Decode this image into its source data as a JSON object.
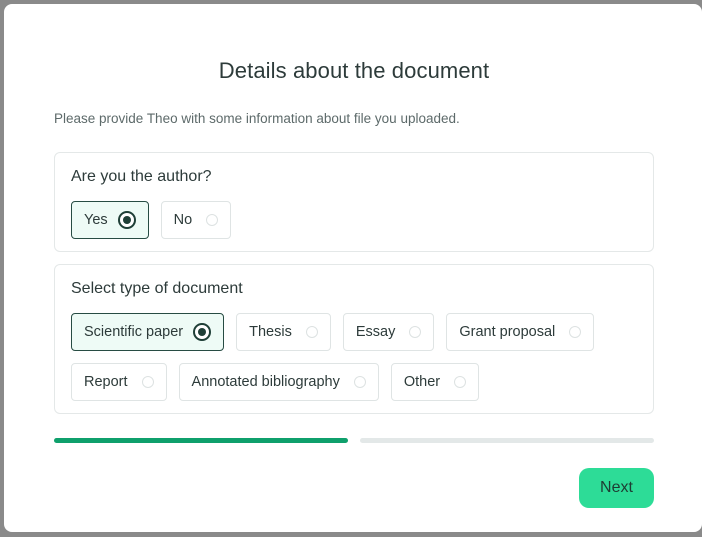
{
  "dialog": {
    "title": "Details about the document",
    "subtitle": "Please provide Theo with some information about file you uploaded."
  },
  "author_question": {
    "title": "Are you the author?",
    "options": [
      {
        "label": "Yes",
        "selected": true
      },
      {
        "label": "No",
        "selected": false
      }
    ]
  },
  "document_type": {
    "title": "Select type of document",
    "options": [
      {
        "label": "Scientific paper",
        "selected": true
      },
      {
        "label": "Thesis",
        "selected": false
      },
      {
        "label": "Essay",
        "selected": false
      },
      {
        "label": "Grant proposal",
        "selected": false
      },
      {
        "label": "Report",
        "selected": false
      },
      {
        "label": "Annotated bibliography",
        "selected": false
      },
      {
        "label": "Other",
        "selected": false
      }
    ]
  },
  "progress": {
    "steps_total": 2,
    "steps_completed": 1
  },
  "footer": {
    "next_label": "Next"
  },
  "colors": {
    "accent": "#2ddc97",
    "progress_done": "#0fa06c",
    "selected_border": "#274c43",
    "selected_bg": "#eefbf6"
  }
}
